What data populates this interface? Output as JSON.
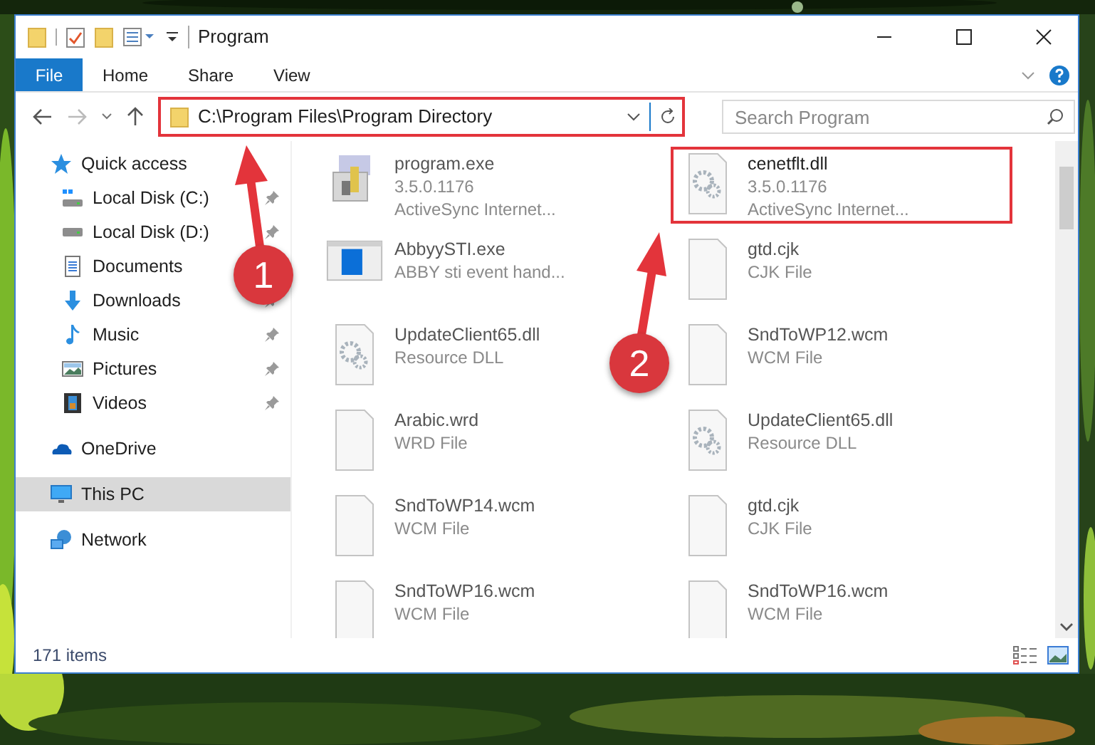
{
  "window": {
    "title": "Program"
  },
  "ribbon_tabs": [
    {
      "label": "File",
      "selected": true
    },
    {
      "label": "Home",
      "selected": false
    },
    {
      "label": "Share",
      "selected": false
    },
    {
      "label": "View",
      "selected": false
    }
  ],
  "address": {
    "value": "C:\\Program Files\\Program Directory",
    "highlighted": true
  },
  "search": {
    "placeholder": "Search Program"
  },
  "sidebar": {
    "items": [
      {
        "label": "Quick access",
        "kind": "star",
        "selected": false,
        "children": [
          {
            "label": "Local Disk (C:)",
            "kind": "sysdrive",
            "pinned": true,
            "selected": false
          },
          {
            "label": "Local Disk (D:)",
            "kind": "drive",
            "pinned": true,
            "selected": false
          },
          {
            "label": "Documents",
            "kind": "documents",
            "selected": false
          },
          {
            "label": "Downloads",
            "kind": "downloads",
            "pinned": true,
            "selected": false
          },
          {
            "label": "Music",
            "kind": "music",
            "pinned": true,
            "selected": false
          },
          {
            "label": "Pictures",
            "kind": "pictures",
            "pinned": true,
            "selected": false
          },
          {
            "label": "Videos",
            "kind": "videos",
            "pinned": true,
            "selected": false
          }
        ]
      },
      {
        "label": "OneDrive",
        "kind": "cloud",
        "selected": false
      },
      {
        "label": "This PC",
        "kind": "pc",
        "selected": true
      },
      {
        "label": "Network",
        "kind": "network",
        "selected": false
      }
    ]
  },
  "files": [
    {
      "name": "program.exe",
      "details": [
        "3.5.0.1176",
        "ActiveSync Internet..."
      ],
      "kind": "installer",
      "highlighted": false
    },
    {
      "name": "cenetflt.dll",
      "details": [
        "3.5.0.1176",
        "ActiveSync Internet..."
      ],
      "kind": "dll",
      "highlighted": true
    },
    {
      "name": "AbbyySTI.exe",
      "details": [
        "ABBY sti event hand..."
      ],
      "kind": "app",
      "highlighted": false
    },
    {
      "name": "gtd.cjk",
      "details": [
        "CJK File"
      ],
      "kind": "file",
      "highlighted": false
    },
    {
      "name": "UpdateClient65.dll",
      "details": [
        "Resource DLL"
      ],
      "kind": "dll",
      "highlighted": false
    },
    {
      "name": "SndToWP12.wcm",
      "details": [
        "WCM File"
      ],
      "kind": "file",
      "highlighted": false
    },
    {
      "name": "Arabic.wrd",
      "details": [
        "WRD File"
      ],
      "kind": "file",
      "highlighted": false
    },
    {
      "name": "UpdateClient65.dll",
      "details": [
        "Resource DLL"
      ],
      "kind": "dll",
      "highlighted": false
    },
    {
      "name": "SndToWP14.wcm",
      "details": [
        "WCM File"
      ],
      "kind": "file",
      "highlighted": false
    },
    {
      "name": "gtd.cjk",
      "details": [
        "CJK File"
      ],
      "kind": "file",
      "highlighted": false
    },
    {
      "name": "SndToWP16.wcm",
      "details": [
        "WCM File"
      ],
      "kind": "file",
      "highlighted": false
    },
    {
      "name": "SndToWP16.wcm",
      "details": [
        "WCM File"
      ],
      "kind": "file",
      "highlighted": false
    }
  ],
  "status_bar": {
    "item_count": "171 items"
  },
  "annotations": [
    {
      "number": "1"
    },
    {
      "number": "2"
    }
  ]
}
